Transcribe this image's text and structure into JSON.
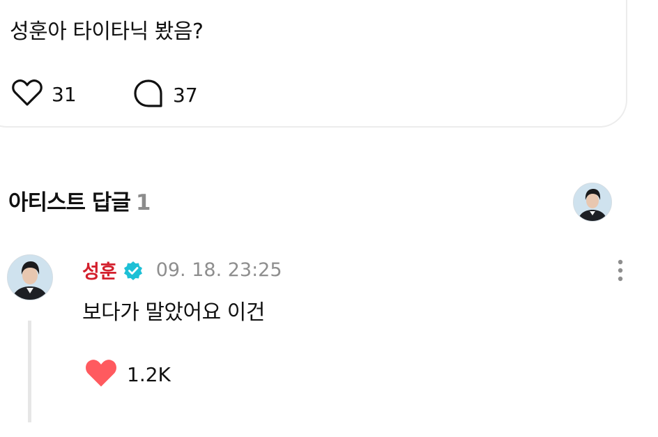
{
  "post": {
    "text": "성훈아 타이타닉 봤음?",
    "like_count": "31",
    "comment_count": "37"
  },
  "artist_section": {
    "title": "아티스트 답글",
    "count": "1"
  },
  "reply": {
    "author": "성훈",
    "timestamp": "09. 18. 23:25",
    "text": "보다가 말았어요 이건",
    "like_count": "1.2K"
  },
  "colors": {
    "author_name": "#d31f2c",
    "verified_badge": "#1ec0d6",
    "liked_heart": "#ff5a5f",
    "muted_text": "#8e8e8e"
  },
  "icons": [
    "heart-outline-icon",
    "comment-bubble-icon",
    "verified-badge-icon",
    "more-vertical-icon",
    "heart-filled-icon"
  ]
}
